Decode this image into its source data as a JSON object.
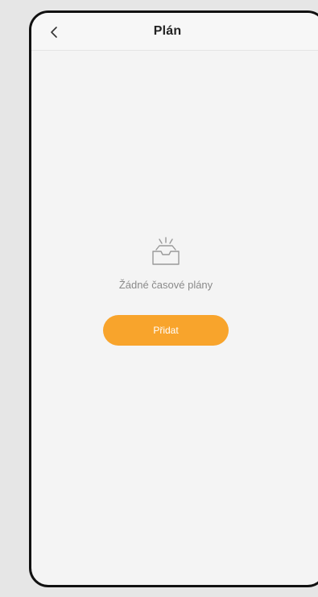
{
  "header": {
    "title": "Plán",
    "back_icon": "chevron-left-icon"
  },
  "empty_state": {
    "icon": "empty-tray-icon",
    "message": "Žádné časové plány",
    "add_label": "Přidat"
  },
  "colors": {
    "accent": "#f8a42c",
    "background": "#f4f4f4",
    "frame": "#111111"
  }
}
